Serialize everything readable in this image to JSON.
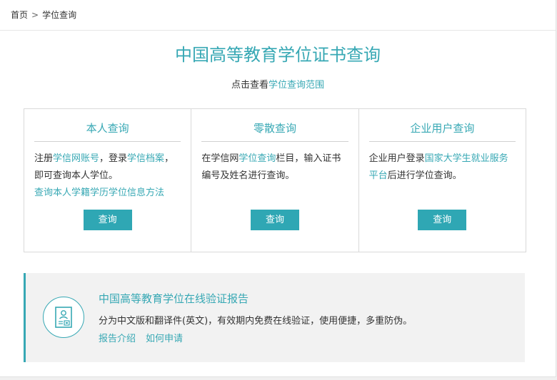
{
  "breadcrumb": {
    "home": "首页",
    "separator": ">",
    "current": "学位查询"
  },
  "page": {
    "title": "中国高等教育学位证书查询",
    "subtitle_text": "点击查看",
    "subtitle_link": "学位查询范围"
  },
  "cards": [
    {
      "title": "本人查询",
      "parts": [
        "注册",
        "学信网账号",
        "，登录",
        "学信档案",
        "，即可查询本人学位。"
      ],
      "extra_link": "查询本人学籍学历学位信息方法",
      "button": "查询"
    },
    {
      "title": "零散查询",
      "parts": [
        "在学信网",
        "学位查询",
        "栏目，输入证书编号及姓名进行查询。"
      ],
      "button": "查询"
    },
    {
      "title": "企业用户查询",
      "parts": [
        "企业用户登录",
        "国家大学生就业服务平台",
        "后进行学位查询。"
      ],
      "button": "查询"
    }
  ],
  "report": {
    "icon": "certificate-icon",
    "title": "中国高等教育学位在线验证报告",
    "description": "分为中文版和翻译件(英文)，有效期内免费在线验证，使用便捷，多重防伪。",
    "links": [
      "报告介绍",
      "如何申请"
    ]
  },
  "colors": {
    "accent": "#37a8b4",
    "button": "#2fa7b4",
    "report_bg": "#f2f2f2"
  }
}
